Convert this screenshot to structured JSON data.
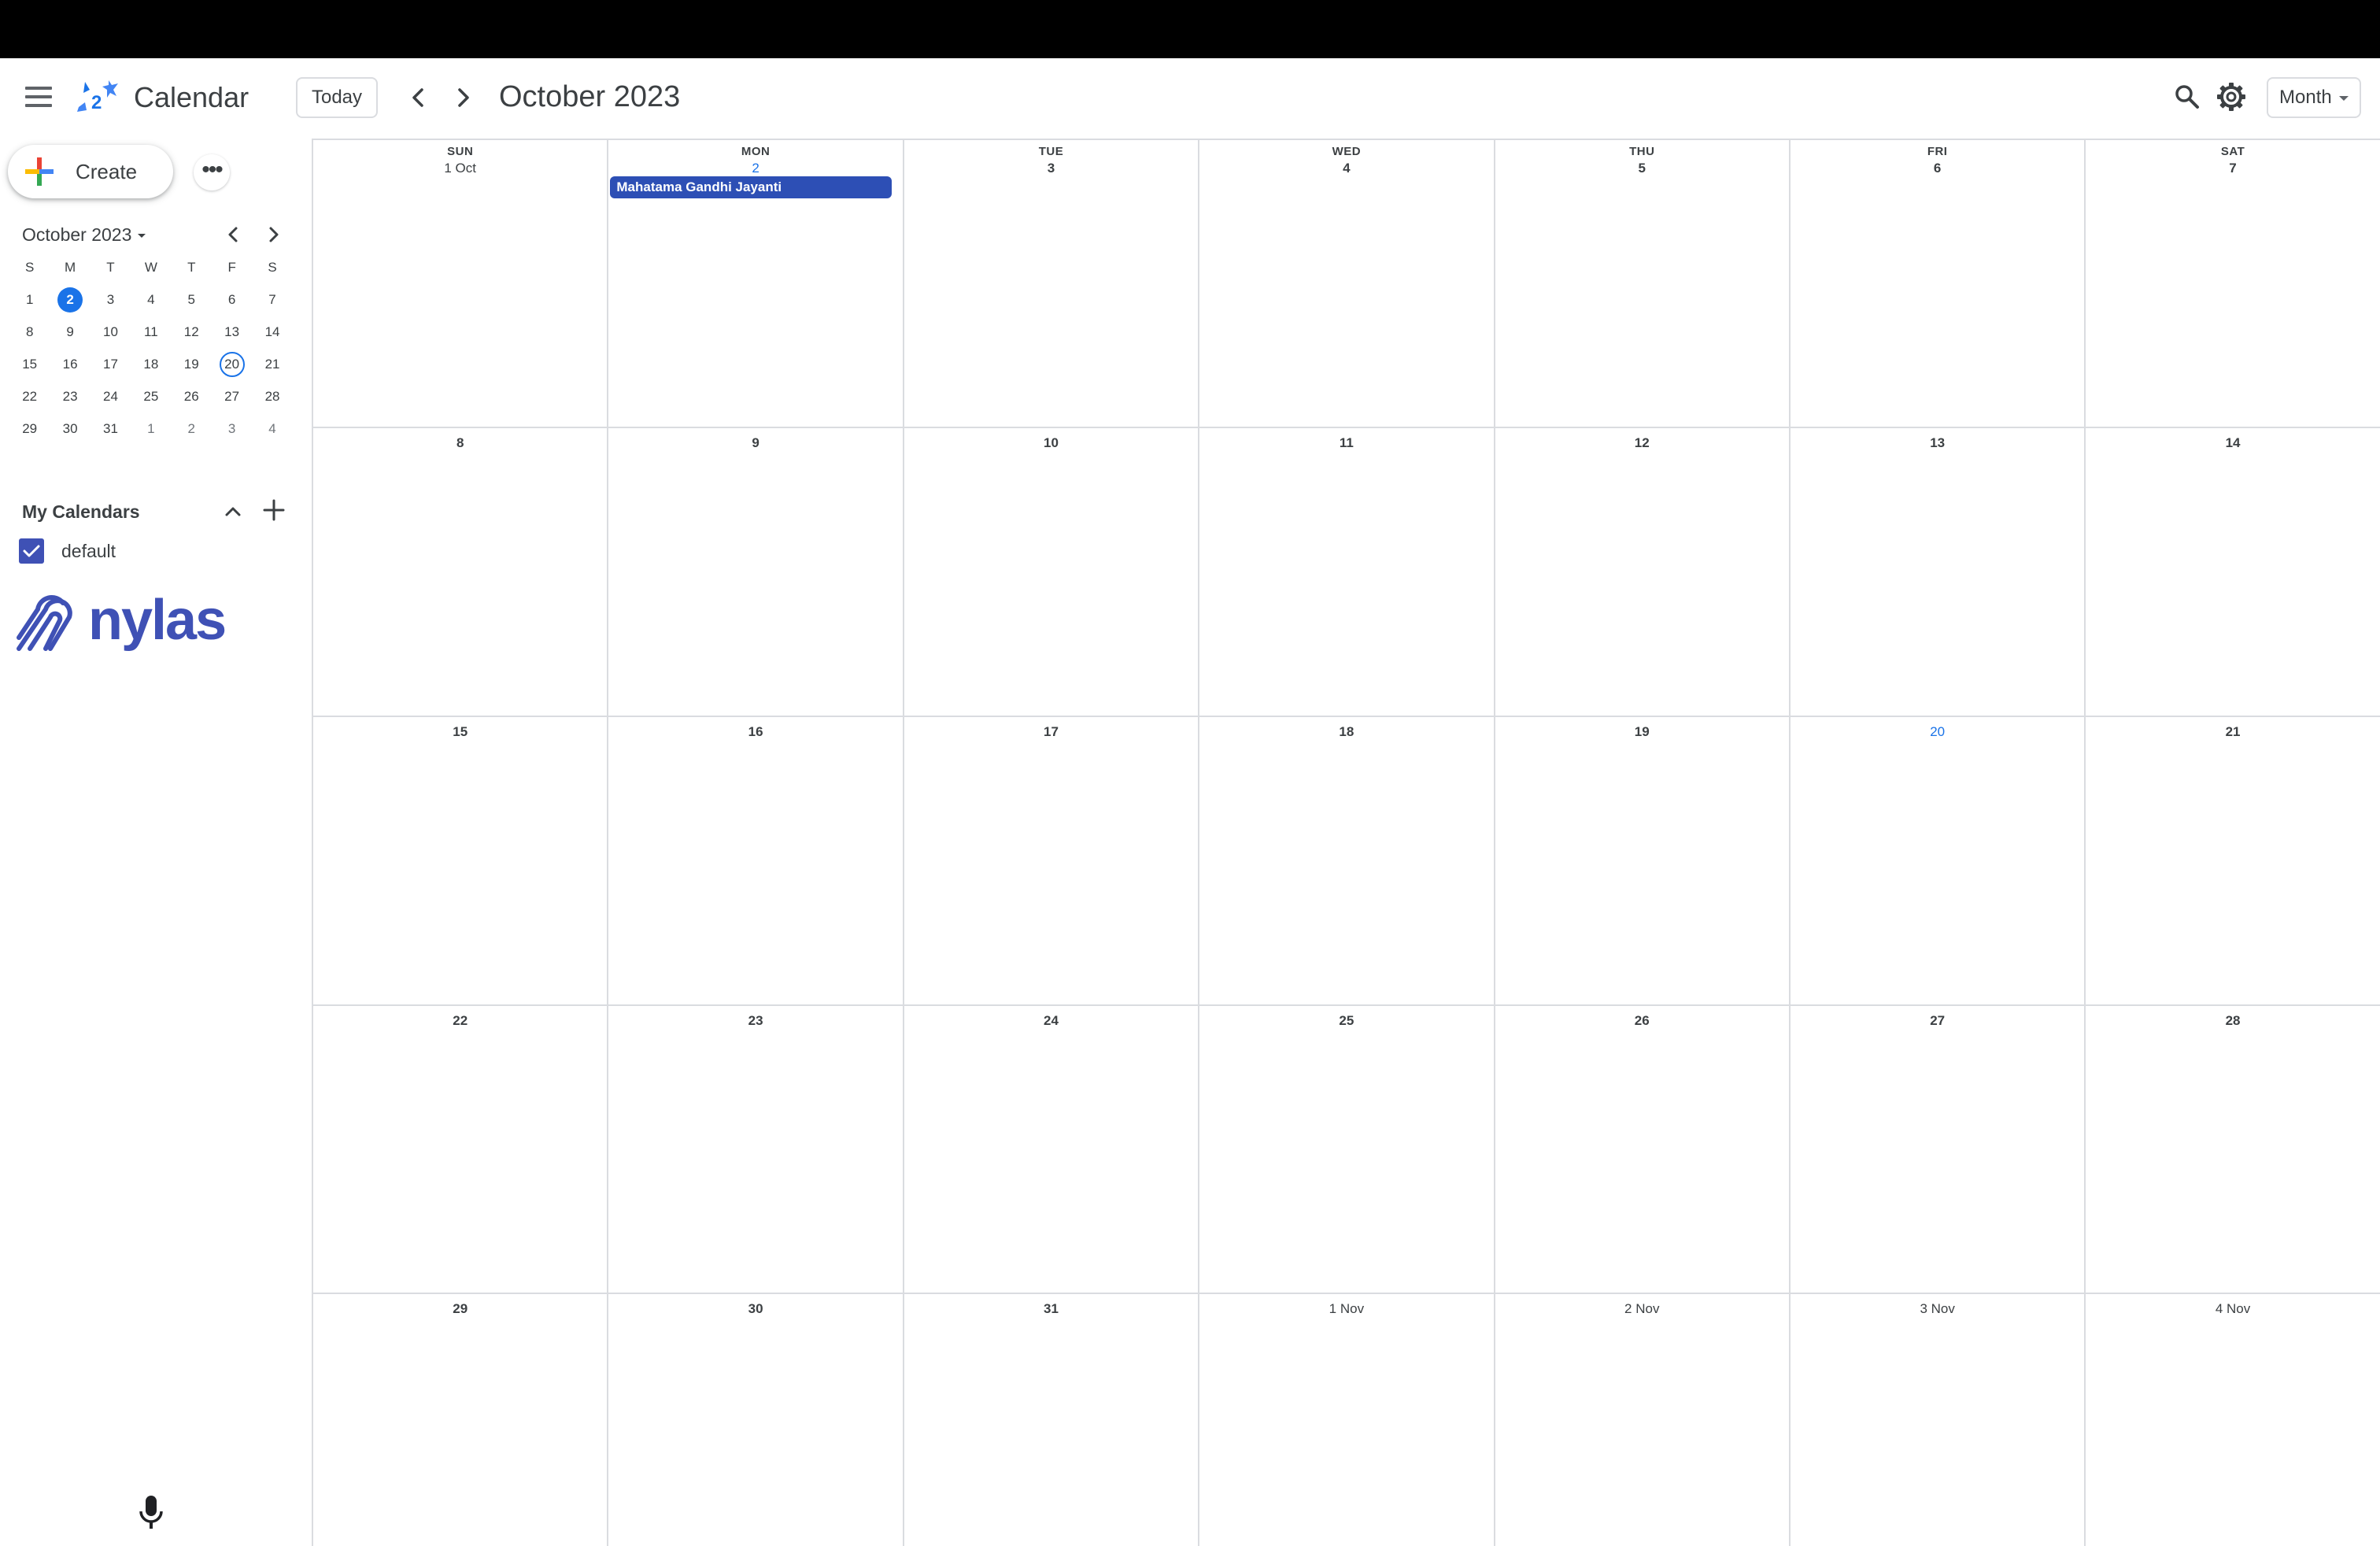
{
  "header": {
    "app_title": "Calendar",
    "today_label": "Today",
    "title": "October 2023",
    "view": "Month"
  },
  "sidebar": {
    "create_label": "Create",
    "more_label": "•••",
    "mini_title": "October 2023",
    "weekday_initials": [
      "S",
      "M",
      "T",
      "W",
      "T",
      "F",
      "S"
    ],
    "mini_weeks": [
      [
        "1",
        "2",
        "3",
        "4",
        "5",
        "6",
        "7"
      ],
      [
        "8",
        "9",
        "10",
        "11",
        "12",
        "13",
        "14"
      ],
      [
        "15",
        "16",
        "17",
        "18",
        "19",
        "20",
        "21"
      ],
      [
        "22",
        "23",
        "24",
        "25",
        "26",
        "27",
        "28"
      ],
      [
        "29",
        "30",
        "31",
        "1",
        "2",
        "3",
        "4"
      ]
    ],
    "selected_day": "2",
    "today_day": "20",
    "my_calendars_title": "My Calendars",
    "calendars": [
      {
        "name": "default",
        "checked": true
      }
    ],
    "brand": "nylas"
  },
  "month": {
    "weekdays": [
      "SUN",
      "MON",
      "TUE",
      "WED",
      "THU",
      "FRI",
      "SAT"
    ],
    "weeks": [
      [
        "1 Oct",
        "2",
        "3",
        "4",
        "5",
        "6",
        "7"
      ],
      [
        "8",
        "9",
        "10",
        "11",
        "12",
        "13",
        "14"
      ],
      [
        "15",
        "16",
        "17",
        "18",
        "19",
        "20",
        "21"
      ],
      [
        "22",
        "23",
        "24",
        "25",
        "26",
        "27",
        "28"
      ],
      [
        "29",
        "30",
        "31",
        "1 Nov",
        "2 Nov",
        "3 Nov",
        "4 Nov"
      ]
    ],
    "event": {
      "title": "Mahatama Gandhi Jayanti",
      "day": "2"
    },
    "today": "20"
  },
  "colors": {
    "accent": "#1a73e8",
    "event": "#2d4fb5",
    "brand": "#3f51b5",
    "grid_line": "#dadce0"
  }
}
